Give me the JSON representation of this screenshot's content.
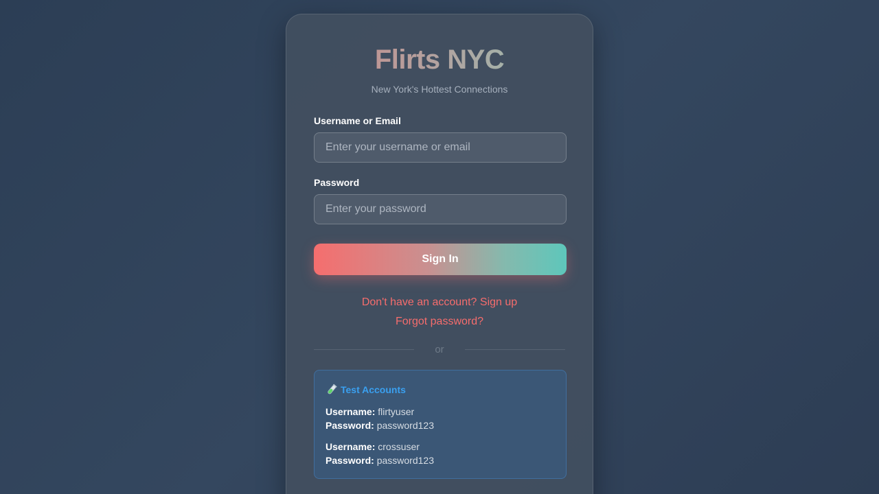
{
  "brand": {
    "title": "Flirts NYC",
    "tagline": "New York's Hottest Connections"
  },
  "form": {
    "username_label": "Username or Email",
    "username_placeholder": "Enter your username or email",
    "username_value": "",
    "password_label": "Password",
    "password_placeholder": "Enter your password",
    "password_value": "",
    "submit_label": "Sign In"
  },
  "links": {
    "signup": "Don't have an account? Sign up",
    "forgot": "Forgot password?"
  },
  "divider": {
    "text": "or"
  },
  "test_accounts": {
    "icon": "test-tube-icon",
    "title": "Test Accounts",
    "username_key": "Username:",
    "password_key": "Password:",
    "accounts": [
      {
        "username": "flirtyuser",
        "password": "password123"
      },
      {
        "username": "crossuser",
        "password": "password123"
      }
    ]
  },
  "colors": {
    "accent_coral": "#f56e6e",
    "accent_teal": "#5ec7bb",
    "link": "#f66d6d",
    "info_blue": "#3aa0f0"
  }
}
